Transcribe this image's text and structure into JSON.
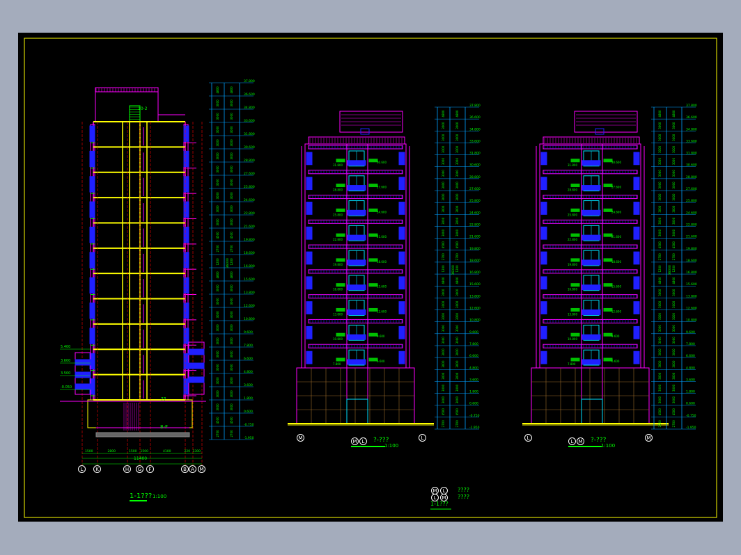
{
  "colors": {
    "background": "#a4acbc",
    "canvas": "#000000",
    "frame": "#ffff00",
    "wall": "#ff00ff",
    "window": "#2020ff",
    "slab": "#ffff00",
    "grid_axis": "#ff0000",
    "text": "#00ff00",
    "dimension": "#00a0ff"
  },
  "section": {
    "title": "1-1???",
    "scale": "1:100",
    "top_spec": "10-2",
    "base_note": "8-F",
    "room_note": "??",
    "axes": [
      "L",
      "K",
      "H",
      "G",
      "F",
      "B",
      "A",
      "M"
    ],
    "dims": [
      "1500",
      "2800",
      "1500",
      "1500",
      "4100",
      "220",
      "1300"
    ],
    "total_dim": "11400",
    "levels_left": [
      "5.400",
      "3.600",
      "3.500",
      "-0.050"
    ]
  },
  "elevation_left": {
    "title": "?-???",
    "scale": "1:100",
    "axes_bottom": [
      "M",
      "L"
    ],
    "title_axes": [
      "M",
      "L"
    ]
  },
  "elevation_right": {
    "title": "?-???",
    "scale": "1:100",
    "axes_bottom": [
      "L",
      "M"
    ],
    "title_axes": [
      "L",
      "M"
    ]
  },
  "legend": {
    "rows": [
      {
        "a": "M",
        "b": "L",
        "text": "????"
      },
      {
        "a": "L",
        "b": "M",
        "text": "????"
      }
    ],
    "title": "1-1???"
  },
  "elevations": [
    "37.800",
    "36.600",
    "34.800",
    "33.600",
    "31.800",
    "30.600",
    "28.800",
    "27.600",
    "25.800",
    "24.600",
    "22.800",
    "21.600",
    "19.800",
    "18.600",
    "16.800",
    "15.600",
    "13.800",
    "12.600",
    "10.800",
    "9.600",
    "7.800",
    "6.600",
    "4.800",
    "3.600",
    "1.800",
    "0.600",
    "-0.750",
    "-1.950"
  ],
  "floor_dims": [
    "4800",
    "3000",
    "3000",
    "3000",
    "3000",
    "3000",
    "3000",
    "3000",
    "3000",
    "3000",
    "3000",
    "4500",
    "2700",
    "1200"
  ],
  "total_height": "36000"
}
